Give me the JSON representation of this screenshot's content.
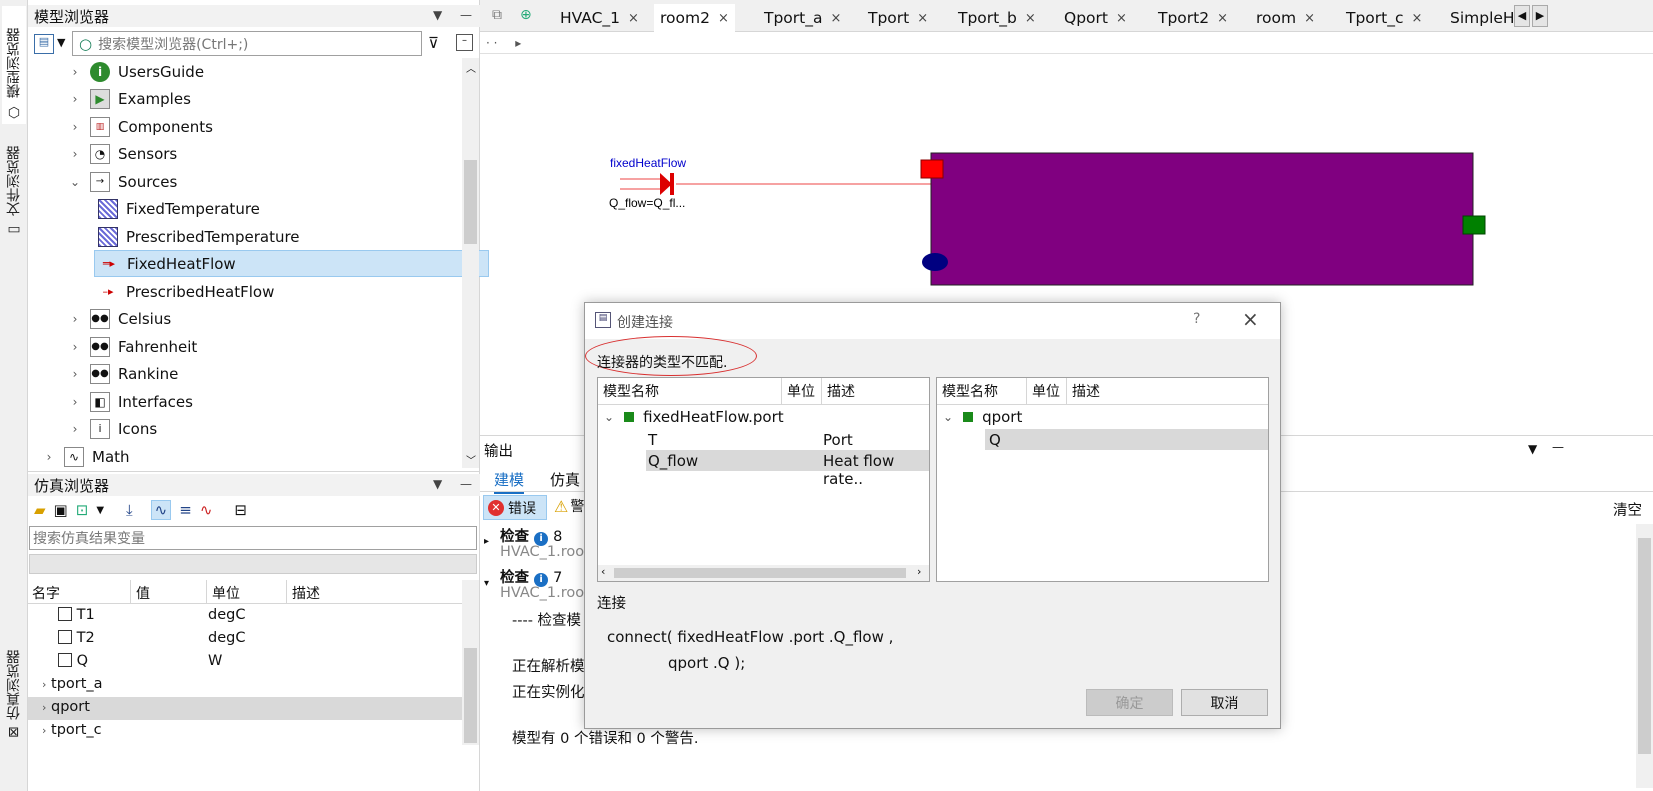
{
  "sidebar_tabs": [
    "模型浏览器",
    "文件浏览器",
    "仿真浏览器"
  ],
  "model_browser": {
    "title": "模型浏览器",
    "search_placeholder": "搜索模型浏览器(Ctrl+;)",
    "items": [
      {
        "label": "UsersGuide",
        "icon": "info-icon"
      },
      {
        "label": "Examples",
        "icon": "play-icon"
      },
      {
        "label": "Components",
        "icon": "components-icon"
      },
      {
        "label": "Sensors",
        "icon": "gauge-icon"
      },
      {
        "label": "Sources",
        "icon": "source-icon"
      },
      {
        "label": "FixedTemperature",
        "icon": "hatch-icon"
      },
      {
        "label": "PrescribedTemperature",
        "icon": "hatch-icon"
      },
      {
        "label": "FixedHeatFlow",
        "icon": "heatflow-icon"
      },
      {
        "label": "PrescribedHeatFlow",
        "icon": "heatflow-icon"
      },
      {
        "label": "Celsius",
        "icon": "dots-icon"
      },
      {
        "label": "Fahrenheit",
        "icon": "dots-icon"
      },
      {
        "label": "Rankine",
        "icon": "dots-icon"
      },
      {
        "label": "Interfaces",
        "icon": "interfaces-icon"
      },
      {
        "label": "Icons",
        "icon": "info-box-icon"
      },
      {
        "label": "Math",
        "icon": "wave-icon"
      }
    ]
  },
  "sim_browser": {
    "title": "仿真浏览器",
    "search_placeholder": "搜索仿真结果变量",
    "columns": [
      "名字",
      "值",
      "单位",
      "描述"
    ],
    "rows": [
      {
        "name": "T1",
        "unit": "degC"
      },
      {
        "name": "T2",
        "unit": "degC"
      },
      {
        "name": "Q",
        "unit": "W"
      }
    ],
    "groups": [
      "tport_a",
      "qport",
      "tport_c"
    ]
  },
  "tabs": [
    "HVAC_1",
    "room2",
    "Tport_a",
    "Tport",
    "Tport_b",
    "Qport",
    "Tport2",
    "room",
    "Tport_c",
    "SimpleHe"
  ],
  "diagram": {
    "component_label": "fixedHeatFlow",
    "param_label": "Q_flow=Q_fl...",
    "colors": {
      "room": "#800080",
      "port_red": "#ff0000",
      "port_green": "#008000",
      "port_navy": "#000080"
    }
  },
  "output": {
    "title": "输出",
    "tabs": [
      "建模",
      "仿真"
    ],
    "filters": {
      "error": "错误",
      "warning": "警"
    },
    "clear": "清空",
    "lines": [
      {
        "head": "检查",
        "count": "8",
        "sub": "HVAC_1.roo"
      },
      {
        "head": "检查",
        "count": "7",
        "sub": "HVAC_1.roo"
      }
    ],
    "body": [
      "---- 检查模",
      "正在解析模",
      "正在实例化",
      "模型有 0 个错误和 0 个警告."
    ]
  },
  "dialog": {
    "title": "创建连接",
    "help": "?",
    "message": "连接器的类型不匹配.",
    "columns": [
      "模型名称",
      "单位",
      "描述"
    ],
    "left_root": "fixedHeatFlow.port",
    "left_rows": [
      {
        "name": "T",
        "desc": "Port temperat.."
      },
      {
        "name": "Q_flow",
        "desc": "Heat flow rate.."
      }
    ],
    "right_root": "qport",
    "right_rows": [
      {
        "name": "Q"
      }
    ],
    "connect_label": "连接",
    "connect_line1": "connect( fixedHeatFlow .port .Q_flow ,",
    "connect_line2": "qport .Q );",
    "ok": "确定",
    "cancel": "取消"
  }
}
